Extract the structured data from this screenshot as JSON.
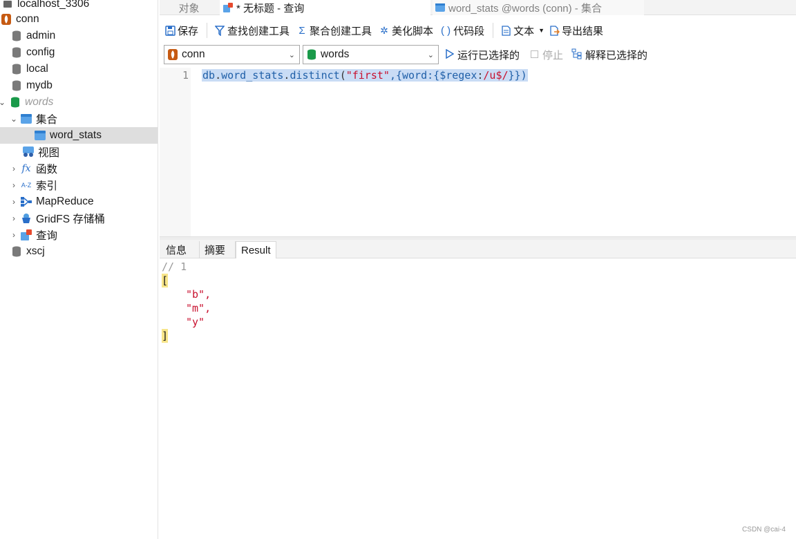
{
  "tabs": [
    {
      "label": "对象",
      "active": false
    },
    {
      "label": "* 无标题 - 查询",
      "active": true
    },
    {
      "label": "word_stats @words (conn) - 集合",
      "active": false
    }
  ],
  "tree": {
    "server": "localhost_3306",
    "connection": "conn",
    "dbs": [
      "admin",
      "config",
      "local",
      "mydb"
    ],
    "current_db": "words",
    "collections_group": "集合",
    "collection": "word_stats",
    "views": "视图",
    "functions": "函数",
    "indexes": "索引",
    "mapreduce": "MapReduce",
    "gridfs": "GridFS 存储桶",
    "queries": "查询",
    "last_db": "xscj"
  },
  "toolbar": {
    "save": "保存",
    "find_builder": "查找创建工具",
    "agg_builder": "聚合创建工具",
    "beautify": "美化脚本",
    "snippet": "代码段",
    "text": "文本",
    "export": "导出结果"
  },
  "selectors": {
    "connection": "conn",
    "database": "words",
    "run_selected": "运行已选择的",
    "stop": "停止",
    "explain": "解释已选择的"
  },
  "editor": {
    "line_number": "1",
    "code_parts": {
      "db": "db",
      "dot1": ".",
      "coll": "word_stats",
      "dot2": ".",
      "fn": "distinct",
      "open": "(",
      "arg": "\"first\"",
      "rest1": ",{word:{",
      "op": "$regex",
      "colon": ":",
      "re": "/u$/",
      "close": "}})"
    }
  },
  "result_tabs": [
    "信息",
    "摘要",
    "Result"
  ],
  "result": {
    "comment": "// 1",
    "open_bracket": "[",
    "items": [
      "\"b\",",
      "\"m\",",
      "\"y\""
    ],
    "close_bracket": "]"
  },
  "watermark": "CSDN @cai-4",
  "colors": {
    "accent": "#2a6fc9",
    "db_green": "#1a9a4a",
    "conn_orange": "#c65a12"
  }
}
